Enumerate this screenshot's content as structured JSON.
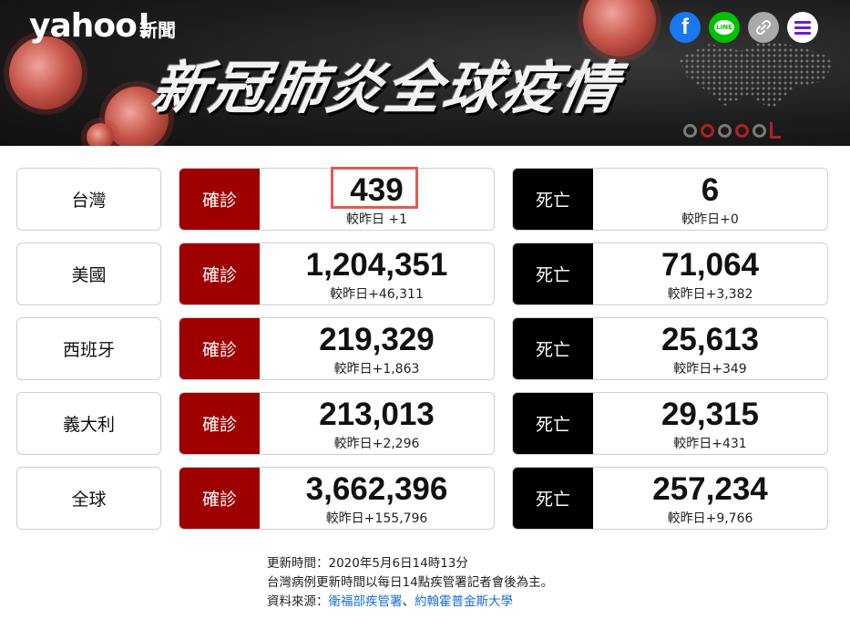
{
  "header": {
    "logo_text": "yahoo!",
    "logo_section": "新聞",
    "headline": "新冠肺炎全球疫情",
    "share": {
      "facebook_glyph": "f",
      "line_glyph": "LINE",
      "link_glyph": "🔗"
    },
    "icons": [
      "facebook-icon",
      "line-icon",
      "link-icon",
      "menu-icon"
    ],
    "colors": {
      "facebook": "#1877f2",
      "line": "#00c300",
      "menu": "#6c1fd1"
    }
  },
  "labels": {
    "confirmed": "確診",
    "deaths": "死亡"
  },
  "rows": [
    {
      "country": "台灣",
      "confirmed": "439",
      "confirmed_delta": "較昨日 +1",
      "deaths": "6",
      "deaths_delta": "較昨日+0"
    },
    {
      "country": "美國",
      "confirmed": "1,204,351",
      "confirmed_delta": "較昨日+46,311",
      "deaths": "71,064",
      "deaths_delta": "較昨日+3,382"
    },
    {
      "country": "西班牙",
      "confirmed": "219,329",
      "confirmed_delta": "較昨日+1,863",
      "deaths": "25,613",
      "deaths_delta": "較昨日+349"
    },
    {
      "country": "義大利",
      "confirmed": "213,013",
      "confirmed_delta": "較昨日+2,296",
      "deaths": "29,315",
      "deaths_delta": "較昨日+431"
    },
    {
      "country": "全球",
      "confirmed": "3,662,396",
      "confirmed_delta": "較昨日+155,796",
      "deaths": "257,234",
      "deaths_delta": "較昨日+9,766"
    }
  ],
  "footer": {
    "updated": "更新時間：2020年5月6日14時13分",
    "note": "台灣病例更新時間以每日14點疾管署記者會後為主。",
    "source_label": "資料來源：",
    "source_1": "衛福部疾管署",
    "separator": "、",
    "source_2": "約翰霍普金斯大學"
  },
  "colors": {
    "confirmed_tag": "#9e0000",
    "deaths_tag": "#000000",
    "highlight": "#e8584a",
    "link": "#1a6dd6"
  }
}
